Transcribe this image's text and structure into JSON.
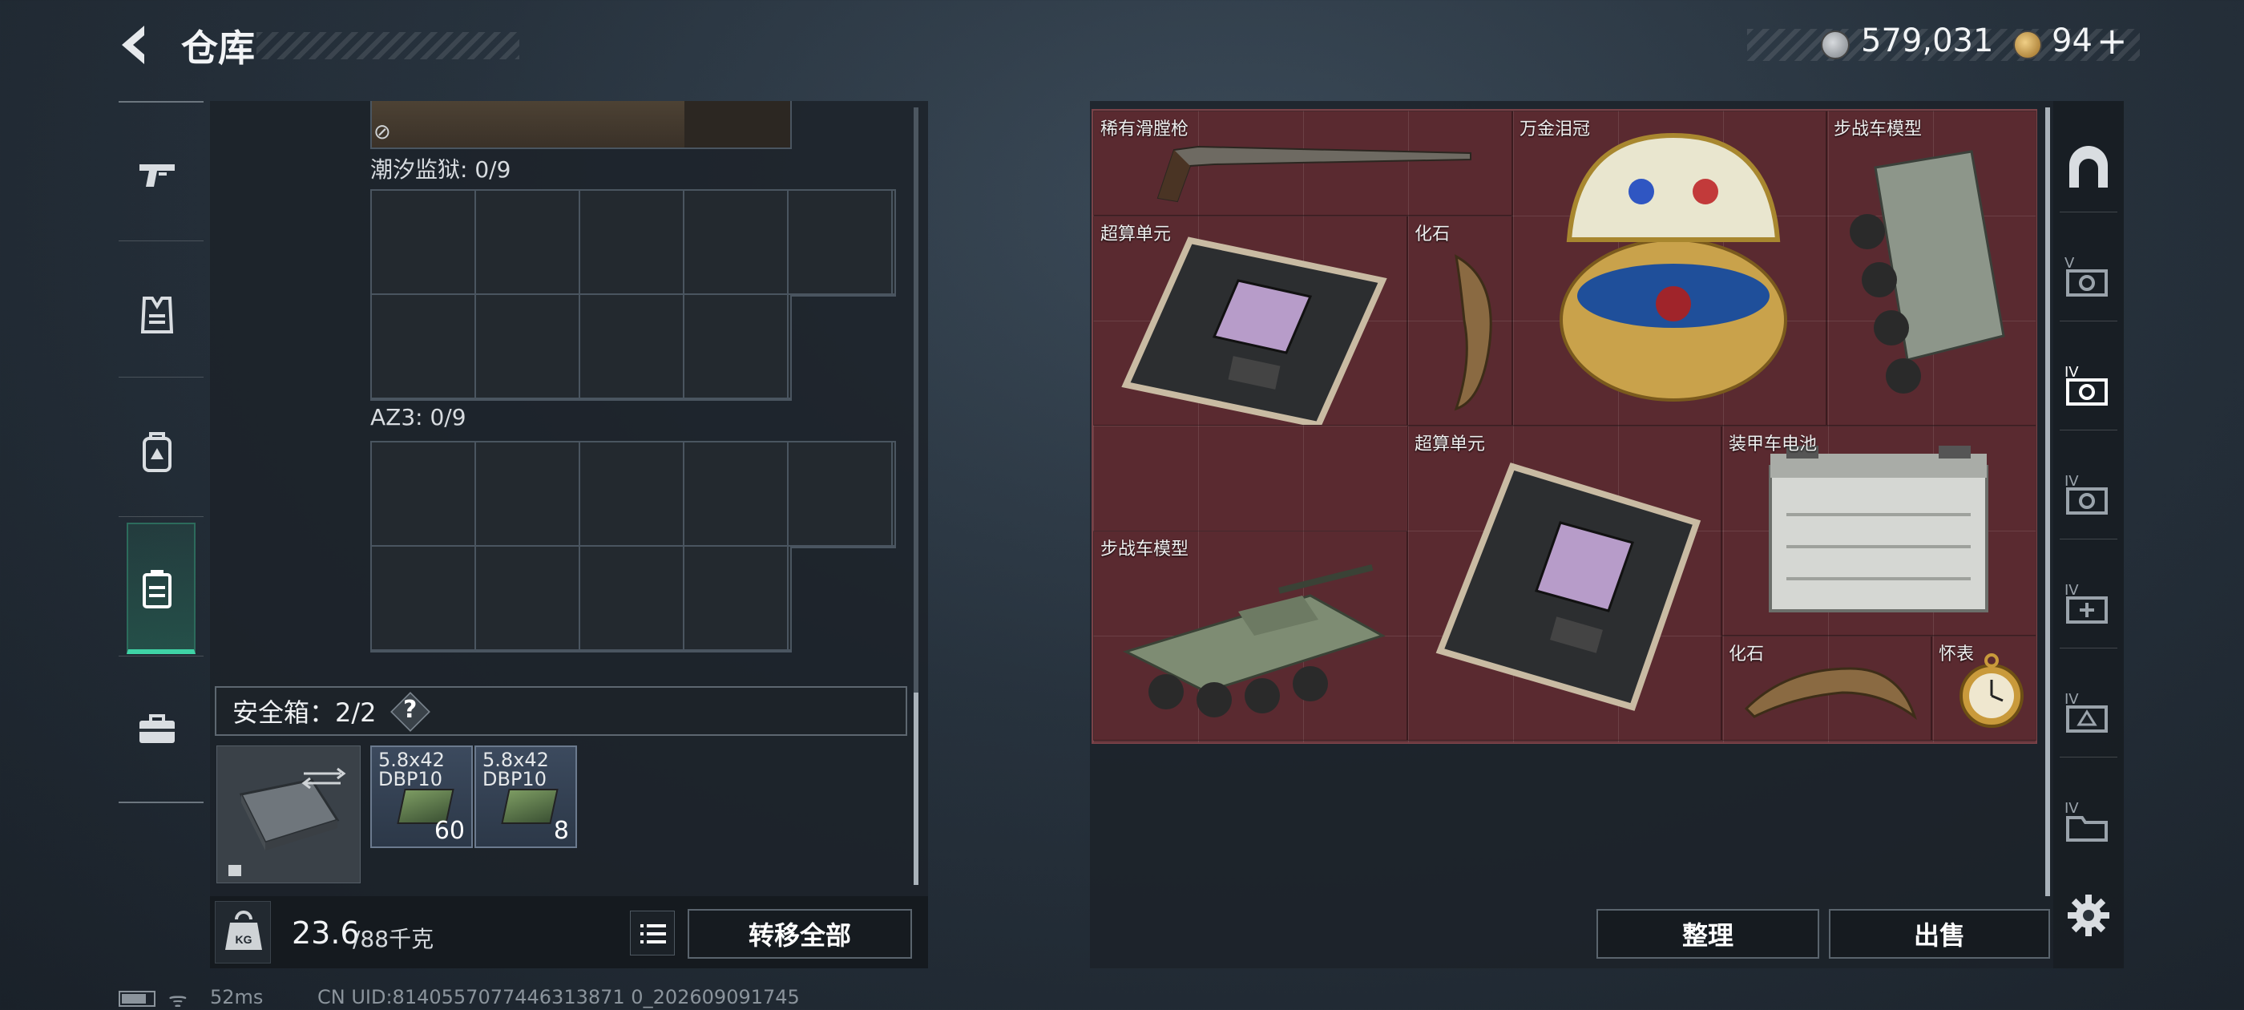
{
  "header": {
    "title": "仓库",
    "currency1": "579,031",
    "currency2": "94",
    "plus": "+"
  },
  "left_tabs": [
    {
      "icon": "gun-icon"
    },
    {
      "icon": "vest-icon"
    },
    {
      "icon": "backpack-icon"
    },
    {
      "icon": "container-icon",
      "active": true
    },
    {
      "icon": "toolbox-icon"
    }
  ],
  "storage": {
    "section1": "潮汐监狱: 0/9",
    "section2": "AZ3: 0/9"
  },
  "safebox": {
    "label": "安全箱：2/2",
    "help": "?",
    "ammo": [
      {
        "name_line1": "5.8x42",
        "name_line2": "DBP10",
        "count": "60"
      },
      {
        "name_line1": "5.8x42",
        "name_line2": "DBP10",
        "count": "8"
      }
    ]
  },
  "bottom_bar": {
    "weight": "23.6",
    "weight_max": "/88千克",
    "weight_icon": "KG",
    "transfer_all": "转移全部"
  },
  "loot": {
    "items": [
      {
        "label": "稀有滑膛枪"
      },
      {
        "label": "万金泪冠"
      },
      {
        "label": "步战车模型"
      },
      {
        "label": "超算单元"
      },
      {
        "label": "化石"
      },
      {
        "label": "超算单元"
      },
      {
        "label": "装甲车电池"
      },
      {
        "label": "步战车模型"
      },
      {
        "label": "化石"
      },
      {
        "label": "怀表"
      }
    ],
    "bg_color": "#5a2a30"
  },
  "right_tabs": [
    {
      "icon": "vault-icon",
      "level": ""
    },
    {
      "icon": "safe-icon",
      "level": "V"
    },
    {
      "icon": "safe-icon",
      "level": "IV",
      "active": true
    },
    {
      "icon": "safe-icon",
      "level": "IV"
    },
    {
      "icon": "medkit-icon",
      "level": "IV"
    },
    {
      "icon": "armor-icon",
      "level": "IV"
    },
    {
      "icon": "folder-icon",
      "level": "IV"
    }
  ],
  "actions": {
    "sort": "整理",
    "sell": "出售"
  },
  "status": {
    "ping": "52ms",
    "uid": "CN UID:8140557077446313871 0_202609091745"
  }
}
